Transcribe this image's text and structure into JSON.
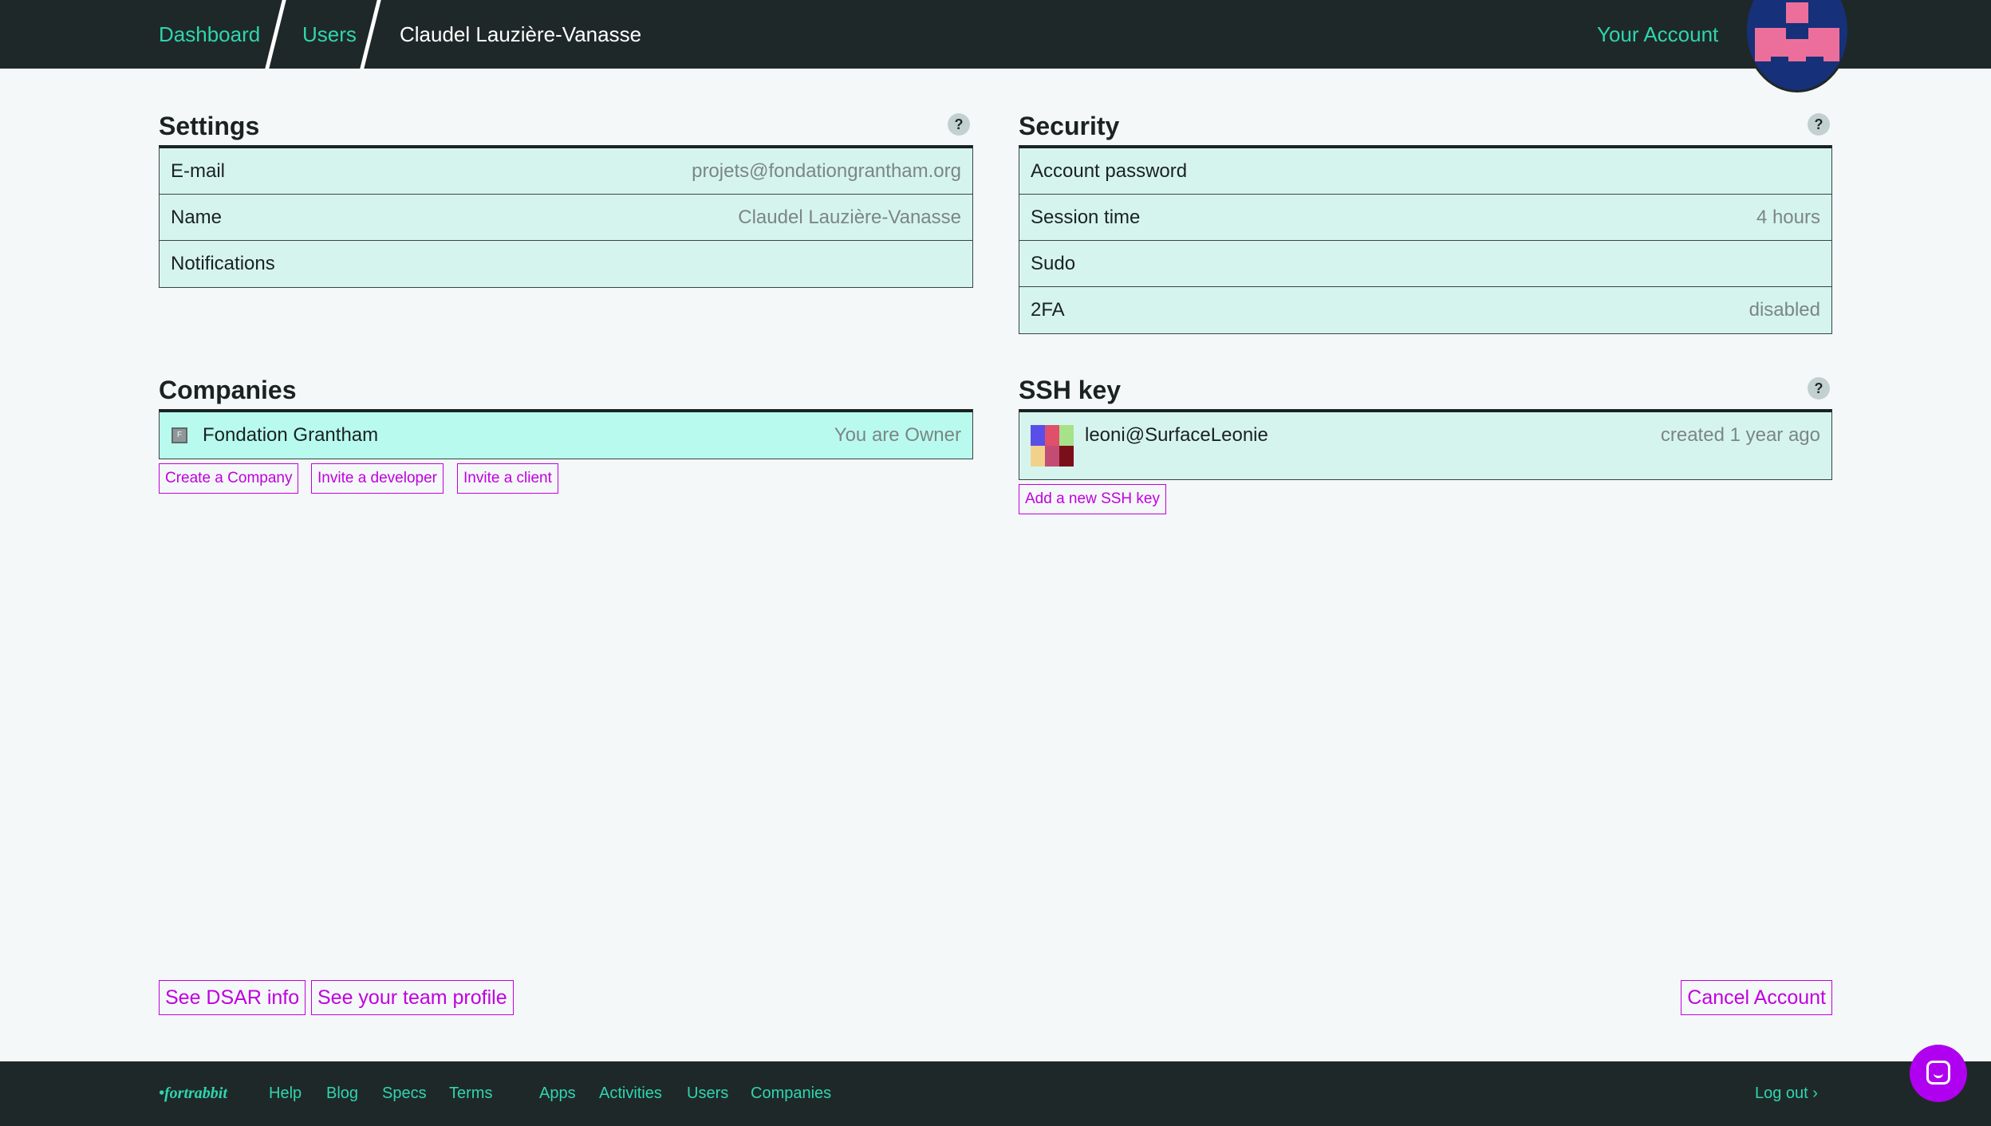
{
  "breadcrumb": {
    "items": [
      "Dashboard",
      "Users"
    ],
    "current": "Claudel Lauzière-Vanasse"
  },
  "header": {
    "account_link": "Your Account"
  },
  "settings": {
    "title": "Settings",
    "help": "?",
    "rows": [
      {
        "label": "E-mail",
        "value": "projets@fondationgrantham.org"
      },
      {
        "label": "Name",
        "value": "Claudel Lauzière-Vanasse"
      },
      {
        "label": "Notifications",
        "value": ""
      }
    ]
  },
  "security": {
    "title": "Security",
    "help": "?",
    "rows": [
      {
        "label": "Account password",
        "value": ""
      },
      {
        "label": "Session time",
        "value": "4 hours"
      },
      {
        "label": "Sudo",
        "value": ""
      },
      {
        "label": "2FA",
        "value": "disabled"
      }
    ]
  },
  "companies": {
    "title": "Companies",
    "items": [
      {
        "icon_letter": "F",
        "name": "Fondation Grantham",
        "role": "You are Owner"
      }
    ],
    "actions": [
      "Create a Company",
      "Invite a developer",
      "Invite a client"
    ]
  },
  "ssh": {
    "title": "SSH key",
    "help": "?",
    "keys": [
      {
        "name": "leoni@SurfaceLeonie",
        "created": "created 1 year ago"
      }
    ],
    "add_label": "Add a new SSH key"
  },
  "bottom_actions": {
    "dsar": "See DSAR info",
    "team_profile": "See your team profile",
    "cancel": "Cancel Account"
  },
  "footer": {
    "logo": "•fortrabbit",
    "links": [
      "Help",
      "Blog",
      "Specs",
      "Terms"
    ],
    "nav": [
      "Apps",
      "Activities",
      "Users",
      "Companies"
    ],
    "logout": "Log out ›"
  },
  "colors": {
    "accent": "#2fd5b0",
    "action": "#c000e0",
    "header_bg": "#1f2828",
    "row_bg": "#d6f4ee"
  }
}
